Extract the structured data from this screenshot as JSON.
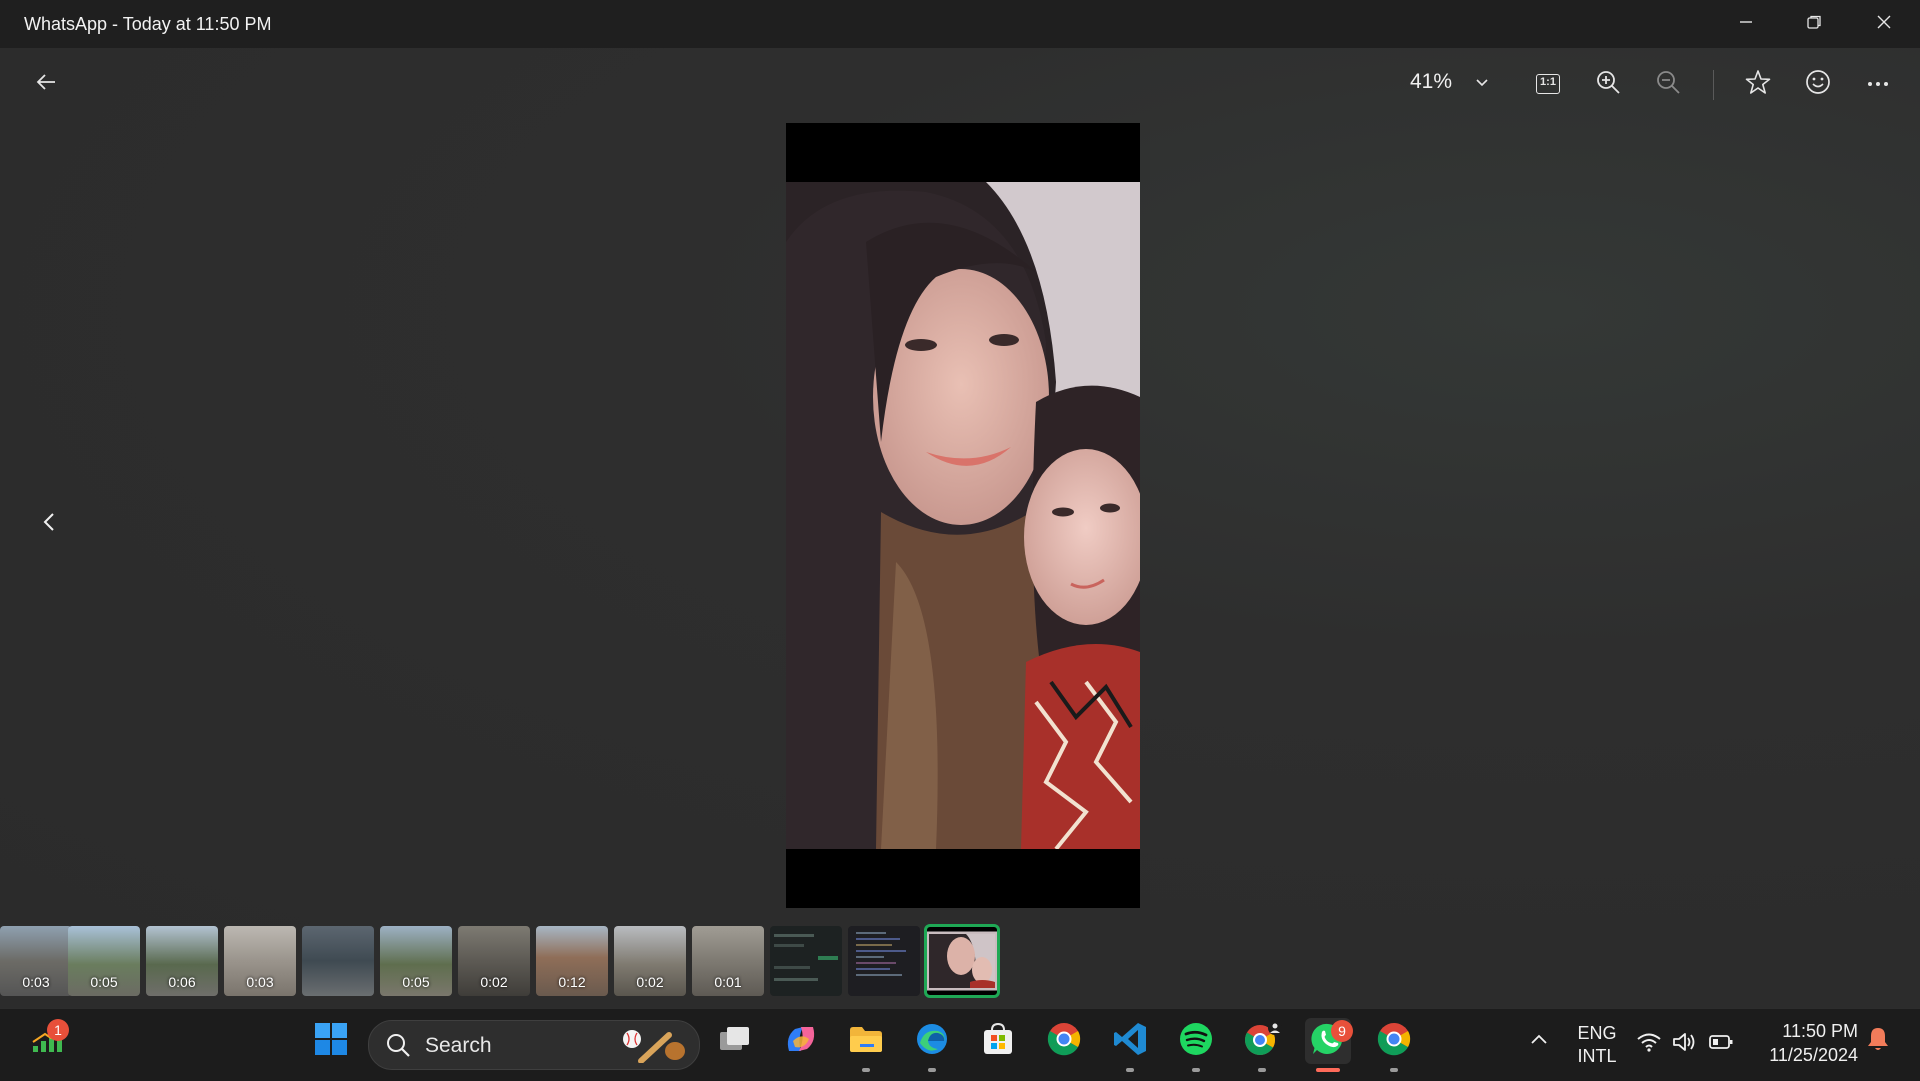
{
  "window": {
    "title": "WhatsApp - Today at 11:50 PM"
  },
  "toolbar": {
    "zoom_level": "41%",
    "actual_size_label": "1:1"
  },
  "filmstrip": {
    "thumbs": [
      {
        "duration": "0:03",
        "kind": "video"
      },
      {
        "duration": "0:05",
        "kind": "video"
      },
      {
        "duration": "0:06",
        "kind": "video"
      },
      {
        "duration": "0:03",
        "kind": "video"
      },
      {
        "duration": "",
        "kind": "photo"
      },
      {
        "duration": "0:05",
        "kind": "video"
      },
      {
        "duration": "0:02",
        "kind": "video"
      },
      {
        "duration": "0:12",
        "kind": "video"
      },
      {
        "duration": "0:02",
        "kind": "video"
      },
      {
        "duration": "0:01",
        "kind": "video"
      },
      {
        "duration": "",
        "kind": "screenshot"
      },
      {
        "duration": "",
        "kind": "screenshot"
      },
      {
        "duration": "",
        "kind": "photo-selected"
      }
    ]
  },
  "taskbar": {
    "widgets_badge": "1",
    "search_label": "Search",
    "whatsapp_badge": "9",
    "language": {
      "line1": "ENG",
      "line2": "INTL"
    },
    "clock": {
      "time": "11:50 PM",
      "date": "11/25/2024"
    }
  },
  "colors": {
    "accent": "#1fa855",
    "badge": "#e8503a",
    "taskbar_bg": "#1c1c1c",
    "titlebar_bg": "#1f1f1f"
  }
}
